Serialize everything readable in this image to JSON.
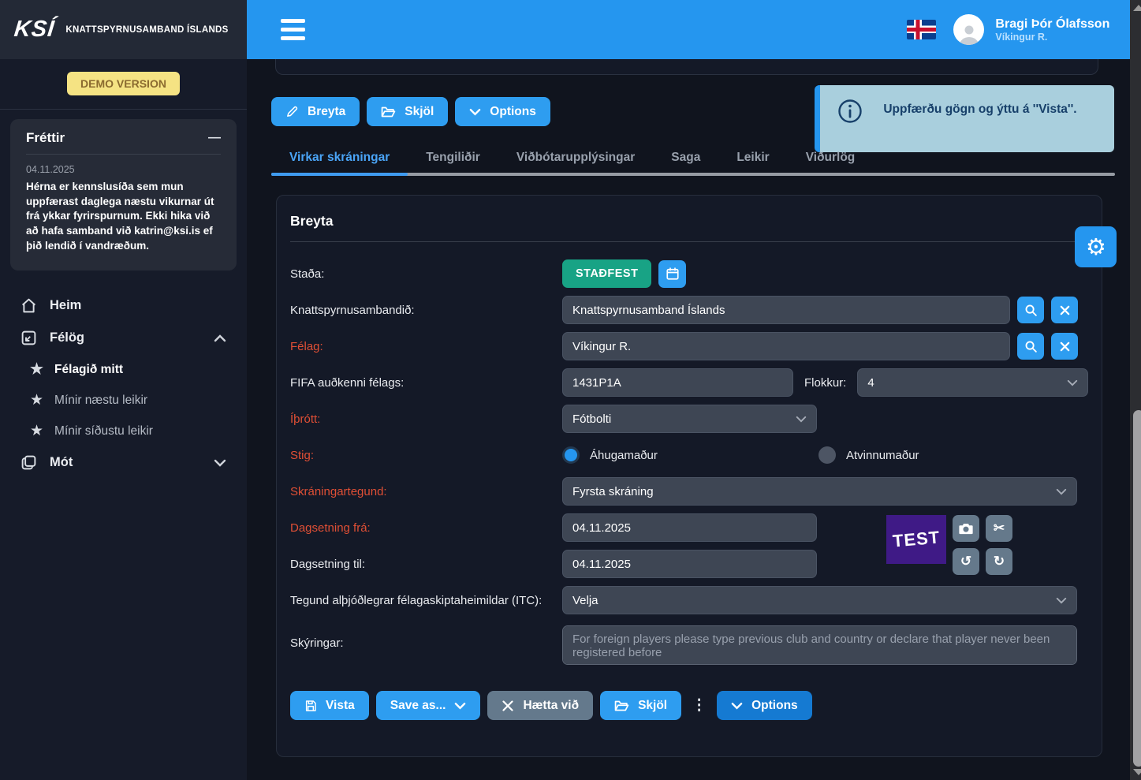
{
  "brand": {
    "logo_text": "KSÍ",
    "org_name": "KNATTSPYRNUSAMBAND ÍSLANDS",
    "demo_badge": "DEMO VERSION"
  },
  "topbar": {
    "user": {
      "name": "Bragi Þór Ólafsson",
      "club": "Víkingur R."
    }
  },
  "news": {
    "title": "Fréttir",
    "date": "04.11.2025",
    "body": "Hérna er kennslusíða sem mun uppfærast daglega næstu vikurnar út frá ykkar fyrirspurnum. Ekki hika við að hafa samband við katrin@ksi.is ef þið lendið í vandræðum."
  },
  "sidebar": {
    "items": [
      {
        "label": "Heim"
      },
      {
        "label": "Félög"
      },
      {
        "label": "Félagið mitt"
      },
      {
        "label": "Mínir næstu leikir"
      },
      {
        "label": "Mínir síðustu leikir"
      },
      {
        "label": "Mót"
      }
    ]
  },
  "toolbar": {
    "breyta": "Breyta",
    "skjol": "Skjöl",
    "options": "Options"
  },
  "notification": {
    "message": "Uppfærðu gögn og ýttu á ''Vista''."
  },
  "tabs": [
    {
      "label": "Virkar skráningar",
      "active": true
    },
    {
      "label": "Tengiliðir",
      "active": false
    },
    {
      "label": "Viðbótarupplýsingar",
      "active": false
    },
    {
      "label": "Saga",
      "active": false
    },
    {
      "label": "Leikir",
      "active": false
    },
    {
      "label": "Viðurlög",
      "active": false
    }
  ],
  "form": {
    "title": "Breyta",
    "stada": {
      "label": "Staða:",
      "value": "STAÐFEST"
    },
    "federation": {
      "label": "Knattspyrnusambandið:",
      "value": "Knattspyrnusamband Íslands"
    },
    "felag": {
      "label": "Félag:",
      "value": "Víkingur R."
    },
    "fifa_id": {
      "label": "FIFA auðkenni félags:",
      "value": "1431P1A"
    },
    "flokkur": {
      "label": "Flokkur:",
      "value": "4"
    },
    "iprott": {
      "label": "Íþrótt:",
      "value": "Fótbolti"
    },
    "stig": {
      "label": "Stig:",
      "options": [
        {
          "label": "Áhugamaður",
          "selected": true
        },
        {
          "label": "Atvinnumaður",
          "selected": false
        }
      ]
    },
    "skraningartegund": {
      "label": "Skráningartegund:",
      "value": "Fyrsta skráning"
    },
    "dags_fra": {
      "label": "Dagsetning frá:",
      "value": "04.11.2025"
    },
    "dags_til": {
      "label": "Dagsetning til:",
      "value": "04.11.2025"
    },
    "itc": {
      "label": "Tegund alþjóðlegrar félagaskiptaheimildar (ITC):",
      "value": "Velja"
    },
    "skyringar": {
      "label": "Skýringar:",
      "placeholder": "For foreign players please type previous club and country or declare that player never been registered before"
    },
    "image_text": "TEST"
  },
  "footer": {
    "vista": "Vista",
    "save_as": "Save as...",
    "haetta_vid": "Hætta við",
    "skjol": "Skjöl",
    "options": "Options"
  },
  "icons": {
    "collapse": "—",
    "star": "★",
    "dots": "⋮",
    "gear": "⚙",
    "scissors": "✂",
    "undo": "↺",
    "redo": "↻",
    "info": "i"
  },
  "colors": {
    "topbar_blue": "#2596ef",
    "button_blue": "#2e9df0",
    "badge_green": "#18a385",
    "required_red": "#e04f35",
    "notification_bg": "#a9cfdd",
    "demo_badge_bg": "#f5e383",
    "image_purple": "#3f1a86"
  }
}
